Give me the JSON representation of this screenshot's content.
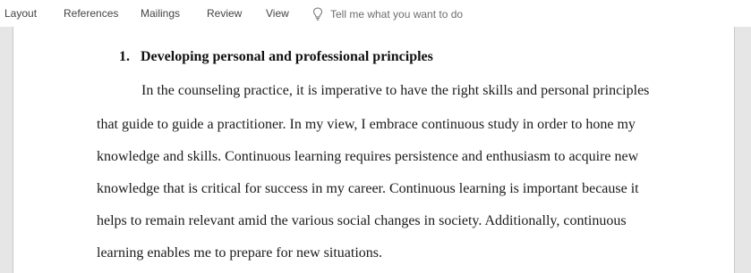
{
  "ribbon": {
    "tabs": [
      {
        "label": "Layout"
      },
      {
        "label": "References"
      },
      {
        "label": "Mailings"
      },
      {
        "label": "Review"
      },
      {
        "label": "View"
      }
    ],
    "tell_me_placeholder": "Tell me what you want to do",
    "tell_me_icon": "lightbulb-icon"
  },
  "document": {
    "heading": {
      "number": "1.",
      "text": "Developing personal and professional principles"
    },
    "paragraph_lines": [
      "In the counseling practice, it is imperative to have the right skills and personal principles",
      "that guide to guide a practitioner. In my view, I embrace continuous study in order to hone my",
      "knowledge and skills. Continuous learning requires persistence and enthusiasm to acquire new",
      "knowledge that is critical for success in my career. Continuous learning is important because it",
      "helps to remain relevant amid the various social changes in society. Additionally, continuous",
      "learning enables me to prepare for new situations."
    ]
  }
}
